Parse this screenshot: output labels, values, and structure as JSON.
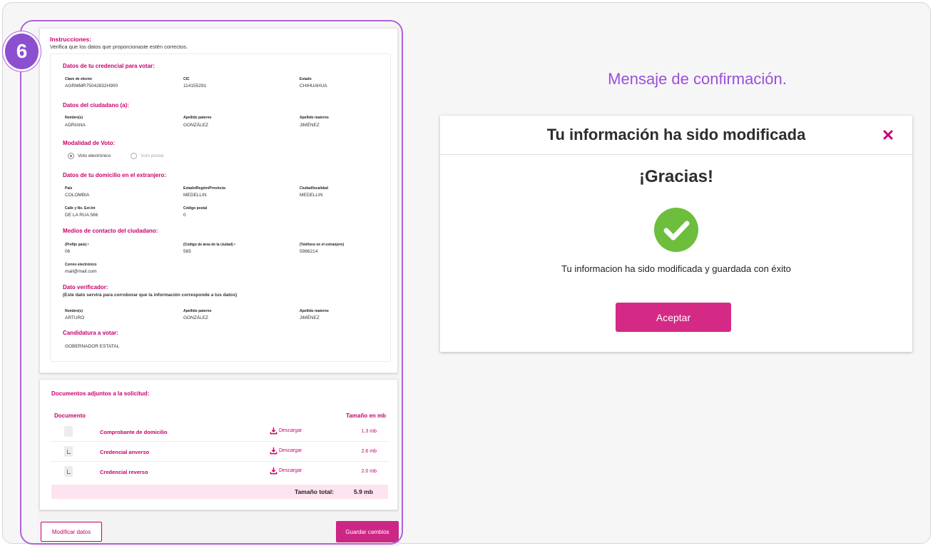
{
  "step_number": "6",
  "form": {
    "instructions_title": "Instrucciones:",
    "instructions_text": "Verifica que los datos que proporcionaste estén correctos.",
    "credential": {
      "title": "Datos de tu credencial para votar:",
      "fields": [
        {
          "label": "Clave de elector",
          "value": "AGRMMR75042832H900"
        },
        {
          "label": "CIC",
          "value": "114155291"
        },
        {
          "label": "Estado",
          "value": "CHIHUAHUA"
        }
      ]
    },
    "citizen": {
      "title": "Datos del ciudadano (a):",
      "fields": [
        {
          "label": "Nombre(s)",
          "value": "ADRIANA"
        },
        {
          "label": "Apellido paterno",
          "value": "GONZÁLEZ"
        },
        {
          "label": "Apellido materno",
          "value": "JIMÉNEZ"
        }
      ]
    },
    "vote_mode": {
      "title": "Modalidad de Voto:",
      "options": [
        {
          "label": "Voto electrónico",
          "selected": true
        },
        {
          "label": "Voto postal",
          "selected": false
        }
      ]
    },
    "address": {
      "title": "Datos de tu domicilio en el extranjero:",
      "fields": [
        {
          "label": "País",
          "value": "COLOMBIA"
        },
        {
          "label": "Estado/Región/Provincia",
          "value": "MEDELLIN"
        },
        {
          "label": "Ciudad/localidad",
          "value": "MEDELLIN"
        },
        {
          "label": "Calle y No. Ext-Int",
          "value": "DE LA RUA 566"
        },
        {
          "label": "Código postal",
          "value": "0"
        }
      ]
    },
    "contact": {
      "title": "Medios de contacto del ciudadano:",
      "fields": [
        {
          "label": "(Prefijo país)  •",
          "value": "06"
        },
        {
          "label": "(Código de área de la ciudad)  •",
          "value": "565"
        },
        {
          "label": "(Teléfono en el extranjero)",
          "value": "5986214"
        },
        {
          "label": "Correo electrónico",
          "value": "mail@mail.com"
        }
      ]
    },
    "verifier": {
      "title": "Dato verificador:",
      "subtitle": "(Este dato servirá para corroborar que la información corresponde a tus datos)",
      "fields": [
        {
          "label": "Nombre(s)",
          "value": "ARTURO"
        },
        {
          "label": "Apellido paterno",
          "value": "GONZÁLEZ"
        },
        {
          "label": "Apellido materno",
          "value": "JIMÉNEZ"
        }
      ]
    },
    "candidacy": {
      "title": "Candidatura a votar:",
      "value": "GOBERNADOR ESTATAL"
    }
  },
  "documents": {
    "title": "Documentos adjuntos a la solicitud:",
    "col_document": "Documento",
    "col_size": "Tamaño en mb",
    "download_label": "Descargar",
    "rows": [
      {
        "name": "Comprobante de domicilio",
        "size": "1.3 mb",
        "icon": "document-icon"
      },
      {
        "name": "Credencial anverso",
        "size": "2.6 mb",
        "icon": "image-file-icon"
      },
      {
        "name": "Credencial reverso",
        "size": "2.0 mb",
        "icon": "image-file-icon"
      }
    ],
    "total_label": "Tamaño total:",
    "total_value": "5.9 mb"
  },
  "buttons": {
    "modify": "Modificar datos",
    "save": "Guardar cambios"
  },
  "caption": "Mensaje de confirmación.",
  "modal": {
    "title": "Tu información ha sido modificada",
    "thanks": "¡Gracias!",
    "message": "Tu informacion ha sido modificada y guardada con éxito",
    "accept": "Aceptar",
    "close_icon": "close-icon",
    "success_icon": "check-circle-icon"
  },
  "colors": {
    "accent": "#c8006f",
    "button": "#d42a86",
    "highlight": "#b061dc",
    "success": "#6cbe3c"
  }
}
